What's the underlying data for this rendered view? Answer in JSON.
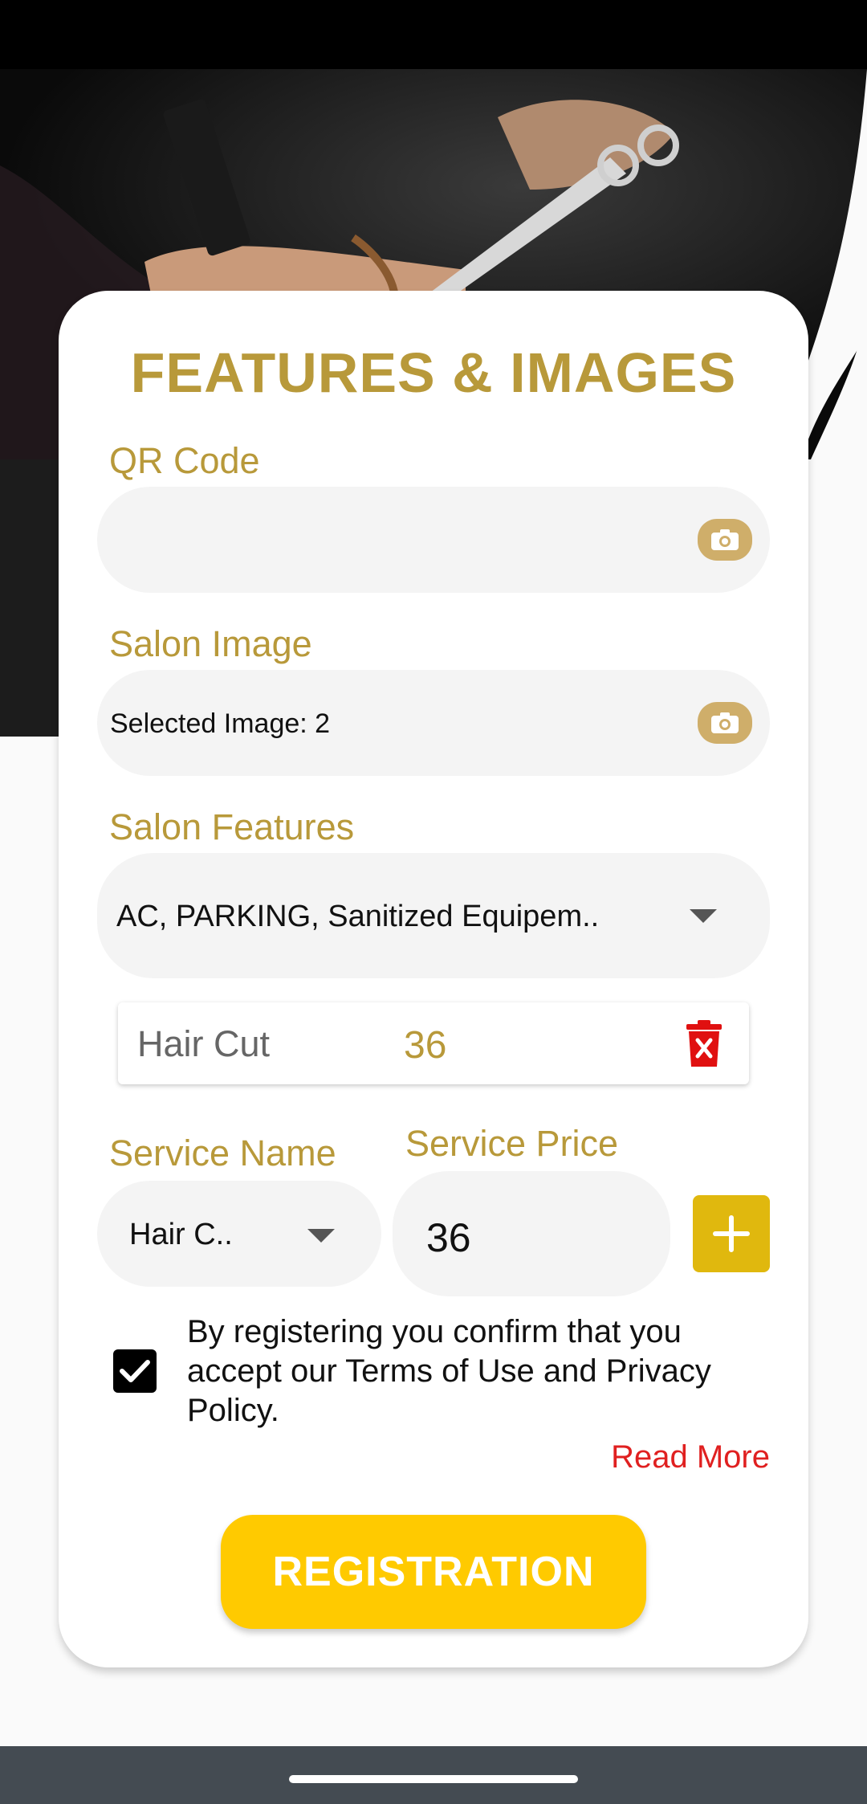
{
  "form": {
    "title": "FEATURES & IMAGES",
    "qr_code": {
      "label": "QR Code",
      "value": "",
      "icon": "camera-icon"
    },
    "salon_image": {
      "label": "Salon Image",
      "value": "Selected Image: 2",
      "icon": "camera-icon"
    },
    "salon_features": {
      "label": "Salon Features",
      "value": "AC, PARKING, Sanitized Equipem.."
    },
    "service_entry": {
      "name": "Hair Cut",
      "price": "36",
      "icon": "delete-icon"
    },
    "service_name": {
      "label": "Service Name",
      "value": "Hair C.."
    },
    "service_price": {
      "label": "Service Price",
      "value": "36"
    },
    "add_icon": "plus-icon",
    "terms": {
      "checked": true,
      "text": "By registering you confirm that you accept our Terms of Use and Privacy Policy."
    },
    "read_more": "Read More",
    "submit_label": "REGISTRATION"
  },
  "colors": {
    "accent_gold": "#b8993a",
    "button_yellow": "#ffca00",
    "add_button": "#e0b80e",
    "delete_red": "#e01010",
    "link_red": "#e02020"
  }
}
